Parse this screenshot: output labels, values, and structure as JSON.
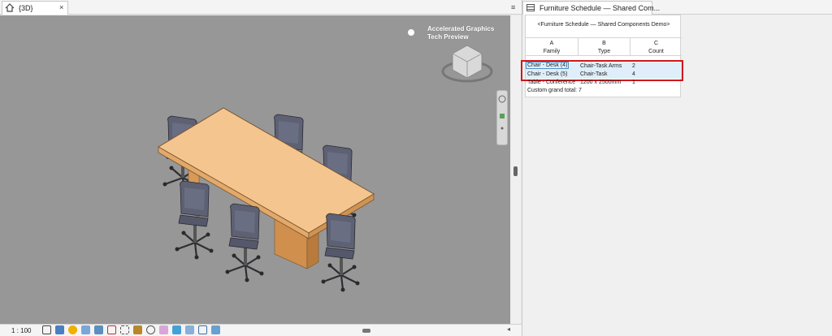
{
  "left_tab": {
    "label": "{3D}",
    "close": "×"
  },
  "left_menu_icon": "≡",
  "viewport": {
    "overlay_text_line1": "Accelerated Graphics",
    "overlay_text_line2": "Tech Preview",
    "background_color": "#979797"
  },
  "status_bar": {
    "scale": "1 : 100"
  },
  "right_tab": {
    "label": "Furniture Schedule — Shared Com..."
  },
  "schedule": {
    "title": "<Furniture Schedule — Shared Components Demo>",
    "columns": [
      {
        "letter": "A",
        "name": "Family"
      },
      {
        "letter": "B",
        "name": "Type"
      },
      {
        "letter": "C",
        "name": "Count"
      }
    ],
    "rows": [
      {
        "family": "Chair - Desk (4)",
        "type": "Chair-Task Arms",
        "count": "2",
        "selected": true
      },
      {
        "family": "Chair - Desk (5)",
        "type": "Chair-Task",
        "count": "4",
        "selected": true
      },
      {
        "family": "Table - Conference",
        "type": "1200 x 2500mm",
        "count": "1",
        "selected": false
      }
    ],
    "grand_total": "Custom grand total: 7"
  },
  "colors": {
    "highlight_box": "#d0161c",
    "selection": "#dfeefa",
    "table_top": "#f4c58e"
  }
}
